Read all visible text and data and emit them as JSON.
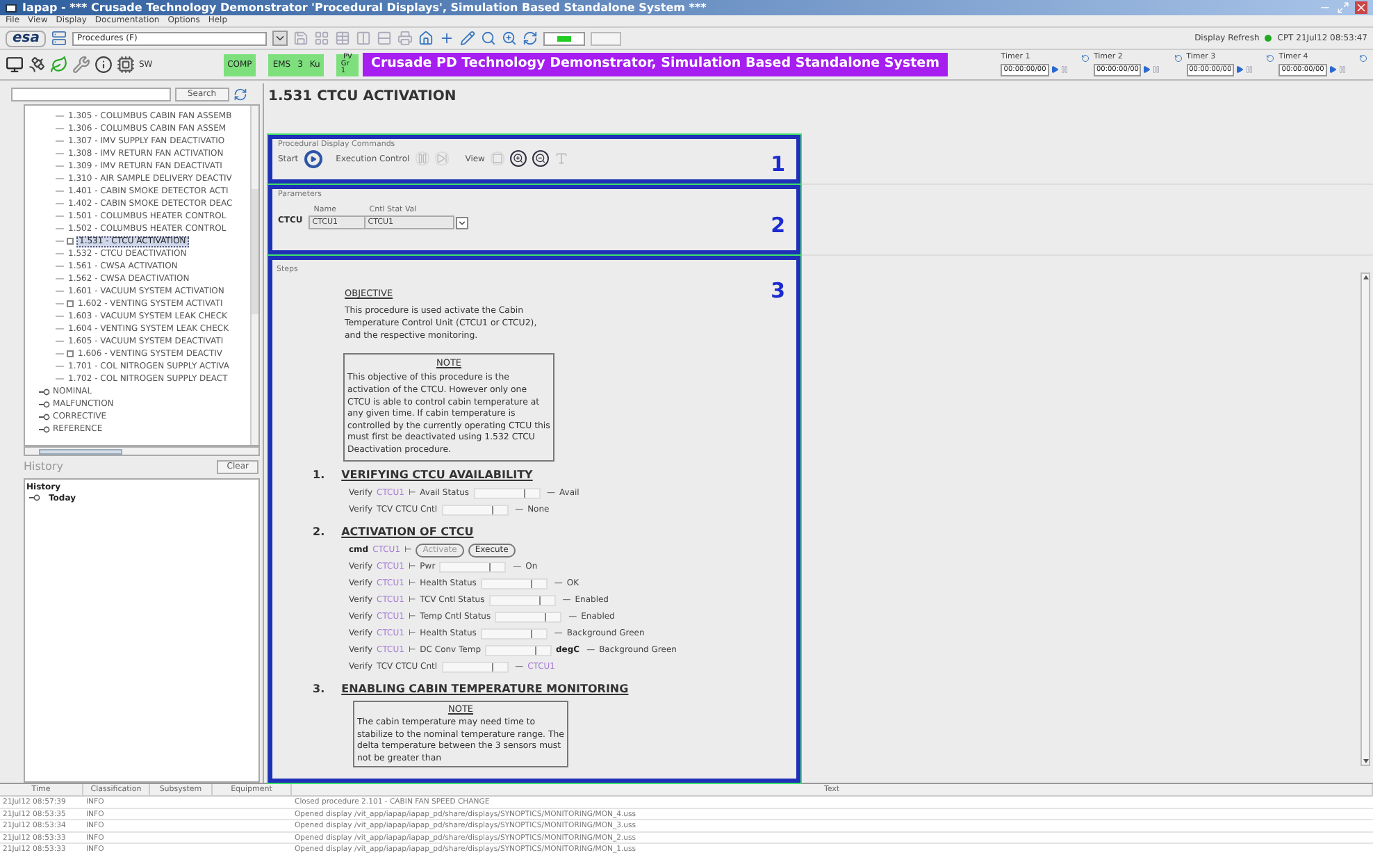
{
  "window": {
    "title": "Iapap - *** Crusade Technology Demonstrator 'Procedural Displays', Simulation Based Standalone System ***"
  },
  "menu": [
    "File",
    "View",
    "Display",
    "Documentation",
    "Options",
    "Help"
  ],
  "toolbar": {
    "logo": "esa",
    "procedure_selector": "Procedures (F)",
    "display_refresh": "Display Refresh",
    "refresh_ok": true,
    "clock": "CPT 21Jul12 08:53:47"
  },
  "status_bar": {
    "sw": "SW",
    "comp": "COMP",
    "ems": [
      "EMS",
      "3",
      "Ku"
    ],
    "pv": [
      "PV",
      "Gr 1"
    ],
    "banner": "Crusade PD Technology Demonstrator, Simulation Based Standalone System",
    "timers": [
      {
        "label": "Timer 1",
        "value": "00:00:00/00"
      },
      {
        "label": "Timer 2",
        "value": "00:00:00/00"
      },
      {
        "label": "Timer 3",
        "value": "00:00:00/00"
      },
      {
        "label": "Timer 4",
        "value": "00:00:00/00"
      }
    ]
  },
  "search": {
    "button": "Search"
  },
  "tree": {
    "items": [
      {
        "label": "1.305 - COLUMBUS CABIN FAN ASSEMB",
        "selected": false,
        "has_children": false
      },
      {
        "label": "1.306 - COLUMBUS CABIN FAN ASSEM",
        "selected": false,
        "has_children": false
      },
      {
        "label": "1.307 - IMV SUPPLY FAN DEACTIVATIO",
        "selected": false,
        "has_children": false
      },
      {
        "label": "1.308 - IMV RETURN FAN ACTIVATION",
        "selected": false,
        "has_children": false
      },
      {
        "label": "1.309 - IMV RETURN FAN DEACTIVATI",
        "selected": false,
        "has_children": false
      },
      {
        "label": "1.310 - AIR SAMPLE DELIVERY DEACTIV",
        "selected": false,
        "has_children": false
      },
      {
        "label": "1.401 - CABIN SMOKE DETECTOR ACTI",
        "selected": false,
        "has_children": false
      },
      {
        "label": "1.402 - CABIN SMOKE DETECTOR DEAC",
        "selected": false,
        "has_children": false
      },
      {
        "label": "1.501 - COLUMBUS HEATER CONTROL",
        "selected": false,
        "has_children": false
      },
      {
        "label": "1.502 - COLUMBUS HEATER CONTROL",
        "selected": false,
        "has_children": false
      },
      {
        "label": "1.531 - CTCU ACTIVATION",
        "selected": true,
        "has_children": true
      },
      {
        "label": "1.532 - CTCU DEACTIVATION",
        "selected": false,
        "has_children": false
      },
      {
        "label": "1.561 - CWSA ACTIVATION",
        "selected": false,
        "has_children": false
      },
      {
        "label": "1.562 - CWSA DEACTIVATION",
        "selected": false,
        "has_children": false
      },
      {
        "label": "1.601 - VACUUM SYSTEM ACTIVATION",
        "selected": false,
        "has_children": false
      },
      {
        "label": "1.602 - VENTING SYSTEM ACTIVATI",
        "selected": false,
        "has_children": true
      },
      {
        "label": "1.603 - VACUUM SYSTEM LEAK CHECK",
        "selected": false,
        "has_children": false
      },
      {
        "label": "1.604 - VENTING SYSTEM LEAK CHECK",
        "selected": false,
        "has_children": false
      },
      {
        "label": "1.605 - VACUUM SYSTEM DEACTIVATI",
        "selected": false,
        "has_children": false
      },
      {
        "label": "1.606 - VENTING SYSTEM DEACTIV",
        "selected": false,
        "has_children": true
      },
      {
        "label": "1.701 - COL NITROGEN SUPPLY ACTIVA",
        "selected": false,
        "has_children": false
      },
      {
        "label": "1.702 - COL NITROGEN SUPPLY DEACT",
        "selected": false,
        "has_children": false
      }
    ],
    "categories": [
      {
        "label": "NOMINAL",
        "expanded": false
      },
      {
        "label": "MALFUNCTION",
        "expanded": false
      },
      {
        "label": "CORRECTIVE",
        "expanded": false
      },
      {
        "label": "REFERENCE",
        "expanded": false
      }
    ]
  },
  "history": {
    "title": "History",
    "clear": "Clear",
    "heading": "History",
    "groups": [
      {
        "label": "Today",
        "expanded": false
      }
    ]
  },
  "procedure": {
    "title": "1.531 CTCU ACTIVATION",
    "commands": {
      "label": "Procedural Display Commands",
      "start": "Start",
      "execution": "Execution Control",
      "view": "View",
      "marker": "1"
    },
    "parameters": {
      "label": "Parameters",
      "group": "CTCU",
      "columns": [
        "Name",
        "Cntl Stat Val"
      ],
      "values": [
        "CTCU1",
        "CTCU1"
      ],
      "marker": "2"
    },
    "steps": {
      "label": "Steps",
      "marker": "3",
      "objective": {
        "heading": "OBJECTIVE",
        "text": "This procedure is used activate the Cabin Temperature Control Unit (CTCU1 or CTCU2), and the respective monitoring."
      },
      "note": {
        "heading": "NOTE",
        "text": "This objective of this procedure is the activation of the CTCU. However only one CTCU is able to control cabin temperature at any given time. If cabin temperature is controlled by the currently operating CTCU this must first be deactivated using 1.532 CTCU Deactivation procedure."
      },
      "sections": [
        {
          "number": "1.",
          "title": "VERIFYING CTCU AVAILABILITY",
          "lines": [
            {
              "kind": "verify",
              "verb": "Verify",
              "param": "CTCU1",
              "separator": "⊢",
              "label": "Avail Status",
              "arrow": "—",
              "expected": "Avail",
              "expected_is_parameter": false
            },
            {
              "kind": "verify",
              "verb": "Verify",
              "label": "TCV CTCU Cntl",
              "arrow": "—",
              "expected": "None",
              "expected_is_parameter": false
            }
          ]
        },
        {
          "number": "2.",
          "title": "ACTIVATION OF CTCU",
          "lines": [
            {
              "kind": "cmd",
              "verb": "cmd",
              "param": "CTCU1",
              "separator": "⊢",
              "buttons": [
                "Activate",
                "Execute"
              ]
            },
            {
              "kind": "verify",
              "verb": "Verify",
              "param": "CTCU1",
              "separator": "⊢",
              "label": "Pwr",
              "arrow": "—",
              "expected": "On",
              "expected_is_parameter": false
            },
            {
              "kind": "verify",
              "verb": "Verify",
              "param": "CTCU1",
              "separator": "⊢",
              "label": "Health Status",
              "arrow": "—",
              "expected": "OK",
              "expected_is_parameter": false
            },
            {
              "kind": "verify",
              "verb": "Verify",
              "param": "CTCU1",
              "separator": "⊢",
              "label": "TCV Cntl Status",
              "arrow": "—",
              "expected": "Enabled",
              "expected_is_parameter": false
            },
            {
              "kind": "verify",
              "verb": "Verify",
              "param": "CTCU1",
              "separator": "⊢",
              "label": "Temp Cntl Status",
              "arrow": "—",
              "expected": "Enabled",
              "expected_is_parameter": false
            },
            {
              "kind": "verify",
              "verb": "Verify",
              "param": "CTCU1",
              "separator": "⊢",
              "label": "Health Status",
              "arrow": "—",
              "expected": "Background Green",
              "expected_is_parameter": false
            },
            {
              "kind": "verify",
              "verb": "Verify",
              "param": "CTCU1",
              "separator": "⊢",
              "label": "DC Conv Temp",
              "unit": "degC",
              "arrow": "—",
              "expected": "Background Green",
              "expected_is_parameter": false
            },
            {
              "kind": "verify",
              "verb": "Verify",
              "label": "TCV CTCU Cntl",
              "arrow": "—",
              "expected": "CTCU1",
              "expected_is_parameter": true
            }
          ]
        },
        {
          "number": "3.",
          "title": "ENABLING CABIN TEMPERATURE MONITORING",
          "note": {
            "heading": "NOTE",
            "text": "The cabin temperature may need time to stabilize to the nominal temperature range. The delta temperature between the 3 sensors must not be greater than"
          }
        }
      ]
    }
  },
  "log": {
    "columns": [
      "Time",
      "Classification",
      "Subsystem",
      "Equipment",
      "Text"
    ],
    "rows": [
      [
        "21Jul12 08:57:39",
        "INFO",
        "",
        "",
        "Closed procedure 2.101 - CABIN FAN SPEED CHANGE"
      ],
      [
        "21Jul12 08:53:35",
        "INFO",
        "",
        "",
        "Opened display /vit_app/iapap/iapap_pd/share/displays/SYNOPTICS/MONITORING/MON_4.uss"
      ],
      [
        "21Jul12 08:53:34",
        "INFO",
        "",
        "",
        "Opened display /vit_app/iapap/iapap_pd/share/displays/SYNOPTICS/MONITORING/MON_3.uss"
      ],
      [
        "21Jul12 08:53:33",
        "INFO",
        "",
        "",
        "Opened display /vit_app/iapap/iapap_pd/share/displays/SYNOPTICS/MONITORING/MON_2.uss"
      ],
      [
        "21Jul12 08:53:33",
        "INFO",
        "",
        "",
        "Opened display /vit_app/iapap/iapap_pd/share/displays/SYNOPTICS/MONITORING/MON_1.uss"
      ]
    ]
  }
}
